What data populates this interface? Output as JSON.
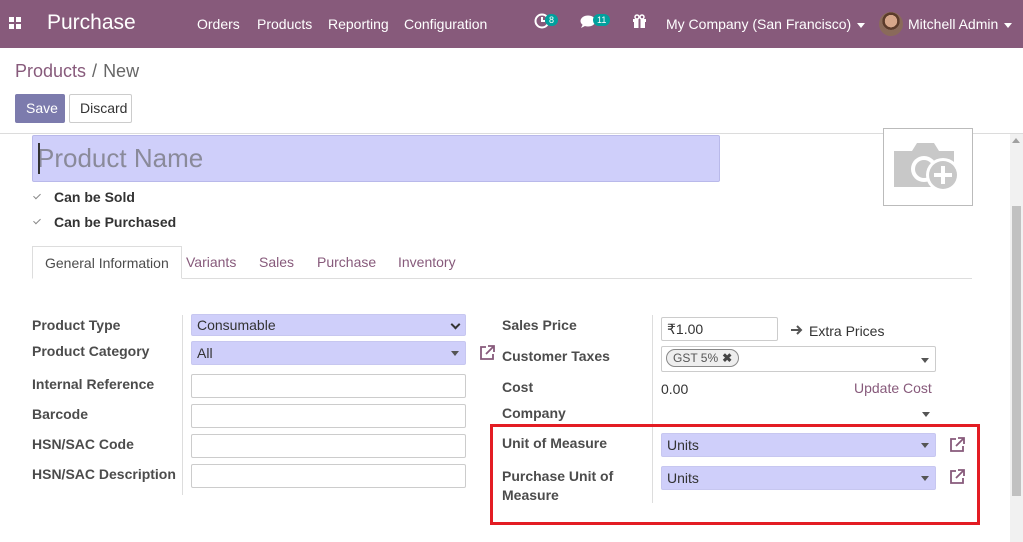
{
  "navbar": {
    "brand": "Purchase",
    "menu": [
      "Orders",
      "Products",
      "Reporting",
      "Configuration"
    ],
    "activity_count": "8",
    "message_count": "11",
    "company": "My Company (San Francisco)",
    "user": "Mitchell Admin",
    "color": "#875a7b"
  },
  "breadcrumb": {
    "parent": "Products",
    "separator": "/",
    "current": "New"
  },
  "buttons": {
    "save": "Save",
    "discard": "Discard"
  },
  "form": {
    "name_placeholder": "Product Name",
    "can_be_sold": "Can be Sold",
    "can_be_purchased": "Can be Purchased",
    "tabs": [
      "General Information",
      "Variants",
      "Sales",
      "Purchase",
      "Inventory"
    ],
    "left": {
      "product_type_label": "Product Type",
      "product_type_value": "Consumable",
      "product_category_label": "Product Category",
      "product_category_value": "All",
      "internal_reference_label": "Internal Reference",
      "barcode_label": "Barcode",
      "hsn_code_label": "HSN/SAC Code",
      "hsn_desc_label": "HSN/SAC Description"
    },
    "right": {
      "sales_price_label": "Sales Price",
      "sales_price_value": "₹1.00",
      "extra_prices": "Extra Prices",
      "customer_taxes_label": "Customer Taxes",
      "customer_taxes_tag": "GST 5%",
      "cost_label": "Cost",
      "cost_value": "0.00",
      "update_cost": "Update Cost",
      "company_label": "Company",
      "uom_label": "Unit of Measure",
      "uom_value": "Units",
      "purchase_uom_label_1": "Purchase Unit of",
      "purchase_uom_label_2": "Measure",
      "purchase_uom_value": "Units"
    }
  },
  "colors": {
    "required_field": "#cfcffa",
    "highlight": "#e31c23",
    "primary_button": "#7c7bad"
  }
}
